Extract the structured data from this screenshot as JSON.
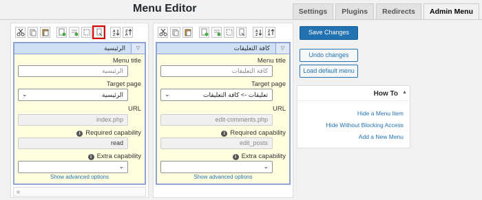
{
  "header": {
    "title": "Menu Editor",
    "tabs": [
      {
        "label": "Settings",
        "active": false
      },
      {
        "label": "Plugins",
        "active": false
      },
      {
        "label": "Redirects",
        "active": false
      },
      {
        "label": "Admin Menu",
        "active": true
      }
    ]
  },
  "toolbar_icons": [
    "cut-icon",
    "copy-icon",
    "paste-icon",
    "new-menu-icon",
    "new-separator-icon",
    "hide-icon",
    "new-item-icon",
    "sort-asc-icon",
    "sort-desc-icon"
  ],
  "left_column": {
    "highlighted_tool": "new-item-icon",
    "panel_title": "الرئيسية",
    "menu_title_label": "Menu title",
    "menu_title_value": "الرئيسية",
    "target_page_label": "Target page",
    "target_page_value": "الرئيسية",
    "url_label": "URL",
    "url_value": "index.php",
    "required_cap_label": "Required capability",
    "required_cap_value": "read",
    "extra_cap_label": "Extra capability",
    "extra_cap_value": "",
    "advanced_link": "Show advanced options"
  },
  "right_column": {
    "panel_title": "كافة التعليقات",
    "menu_title_label": "Menu title",
    "menu_title_value": "كافة التعليقات",
    "target_page_label": "Target page",
    "target_page_value": "تعليقات -> كافة التعليقات",
    "url_label": "URL",
    "url_value": "edit-comments.php",
    "required_cap_label": "Required capability",
    "required_cap_value": "edit_posts",
    "extra_cap_label": "Extra capability",
    "extra_cap_value": "",
    "advanced_link": "Show advanced options"
  },
  "actions": {
    "save": "Save Changes",
    "undo": "Undo changes",
    "load_default": "Load default menu"
  },
  "howto": {
    "title": "How To",
    "links": [
      "Hide a Menu Item",
      "Hide Without Blocking Access",
      "Add a New Menu"
    ]
  },
  "colors": {
    "accent": "#2271b1",
    "panel_bg": "#ffffe0",
    "panel_border": "#8ea2d4",
    "highlight": "#dd0000"
  }
}
